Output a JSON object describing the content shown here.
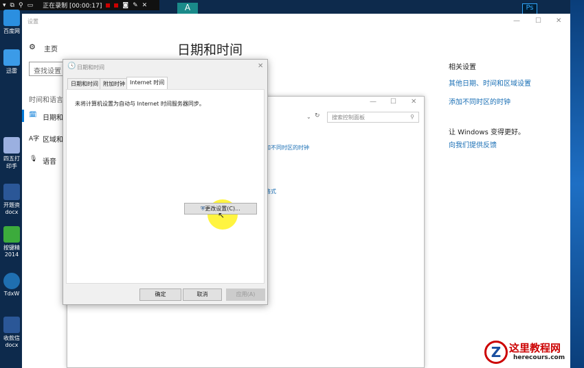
{
  "recorder": {
    "status": "正在录制 [00:00:17]"
  },
  "desktop": {
    "icons": [
      {
        "label": "百度网"
      },
      {
        "label": "迅雷"
      },
      {
        "label": "四五打印手"
      },
      {
        "label": "开题资docx"
      },
      {
        "label": "按键精2014"
      },
      {
        "label": "TdxW"
      },
      {
        "label": "收款信docx"
      }
    ]
  },
  "settings": {
    "window_title": "设置",
    "home": "主页",
    "search_placeholder": "查找设置",
    "section": "时间和语言",
    "nav": [
      {
        "label": "日期和时间"
      },
      {
        "label": "区域和语言"
      },
      {
        "label": "语音"
      }
    ],
    "heading": "日期和时间",
    "related_title": "相关设置",
    "related_links": [
      "其他日期、时间和区域设置",
      "添加不同时区的时钟"
    ],
    "improve_title": "让 Windows 变得更好。",
    "feedback_link": "向我们提供反馈"
  },
  "control_panel": {
    "search_placeholder": "搜索控制面板",
    "link1": "添加不同时区的时钟",
    "link2": "字格式"
  },
  "dialog": {
    "title": "日期和时间",
    "tabs": [
      "日期和时间",
      "附加时钟",
      "Internet 时间"
    ],
    "active_tab": 2,
    "message": "未将计算机设置为自动与 Internet 时间服务器同步。",
    "change_button": "更改设置(C)...",
    "ok": "确定",
    "cancel": "取消",
    "apply": "应用(A)"
  },
  "watermark": {
    "name": "这里教程网",
    "url": "herecours.com"
  },
  "colors": {
    "link": "#1a6fb5",
    "accent": "#0078d7"
  }
}
